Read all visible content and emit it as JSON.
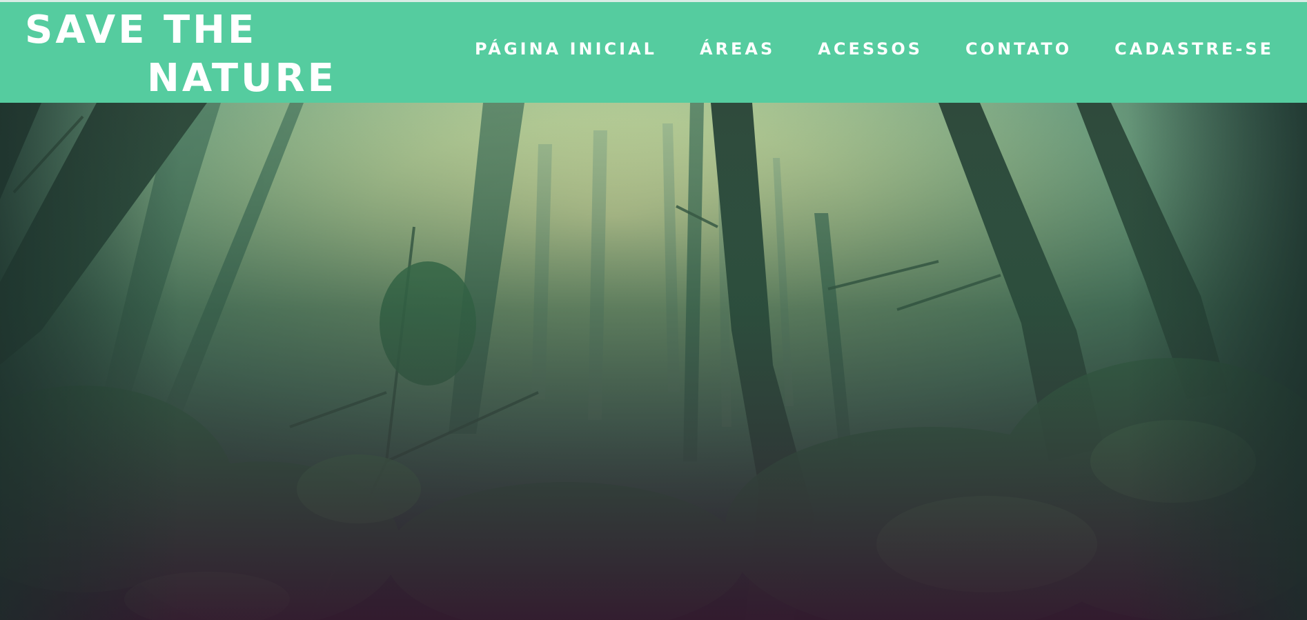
{
  "header": {
    "logo_line1": "SAVE THE",
    "logo_line2": "NATURE",
    "background_color": "#55CC9F"
  },
  "nav": {
    "items": [
      {
        "label": "PÁGINA INICIAL"
      },
      {
        "label": "ÁREAS"
      },
      {
        "label": "ACESSOS"
      },
      {
        "label": "CONTATO"
      },
      {
        "label": "CADASTRE-SE"
      }
    ]
  },
  "hero": {
    "image": "misty-forest-photo"
  }
}
